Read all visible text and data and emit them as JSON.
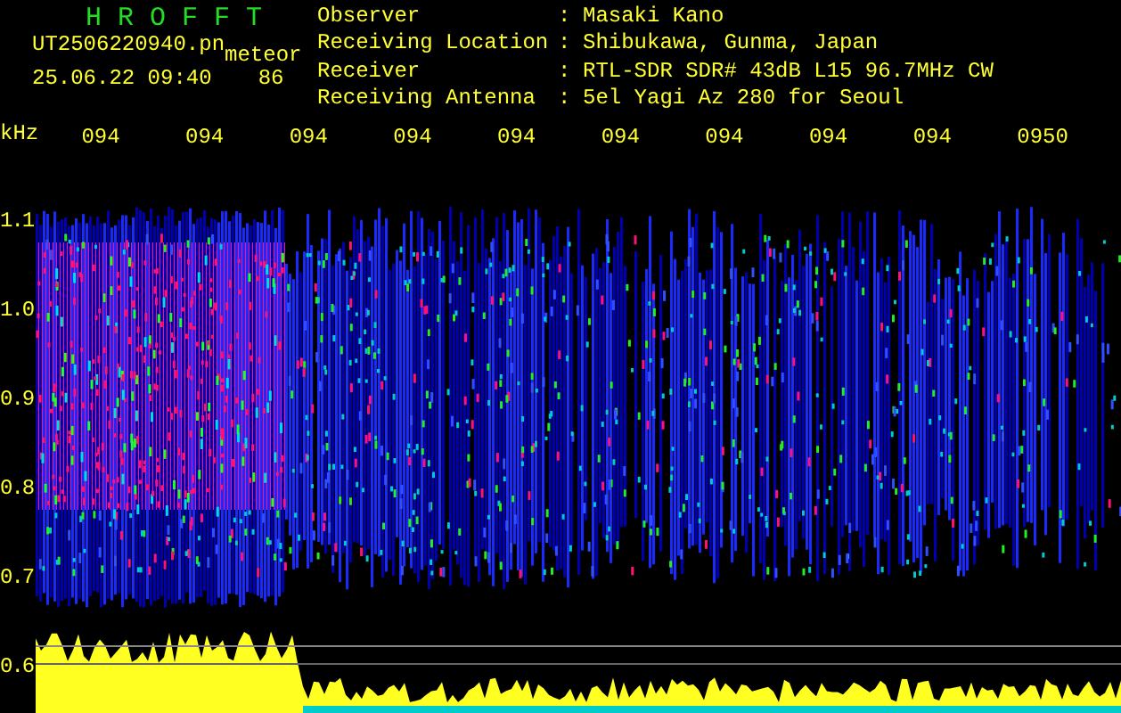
{
  "header": {
    "logo": "H R O F F T",
    "file": "UT2506220940.pn",
    "event_type": "meteor",
    "datetime": "25.06.22 09:40",
    "count": "86"
  },
  "info": [
    {
      "label": "Observer",
      "separator": ":",
      "value": "Masaki Kano"
    },
    {
      "label": "Receiving Location",
      "separator": ":",
      "value": "Shibukawa, Gunma, Japan"
    },
    {
      "label": "Receiver",
      "separator": ":",
      "value": "RTL-SDR SDR# 43dB L15 96.7MHz CW"
    },
    {
      "label": "Receiving Antenna",
      "separator": ":",
      "value": "5el Yagi Az 280 for Seoul"
    }
  ],
  "axis": {
    "unit": "kHz",
    "time_labels": [
      "094",
      "094",
      "094",
      "094",
      "094",
      "094",
      "094",
      "094",
      "094",
      "0950"
    ],
    "frequency_labels": [
      "1.1",
      "1.0",
      "0.9",
      "0.8",
      "0.7",
      "0.6"
    ]
  }
}
